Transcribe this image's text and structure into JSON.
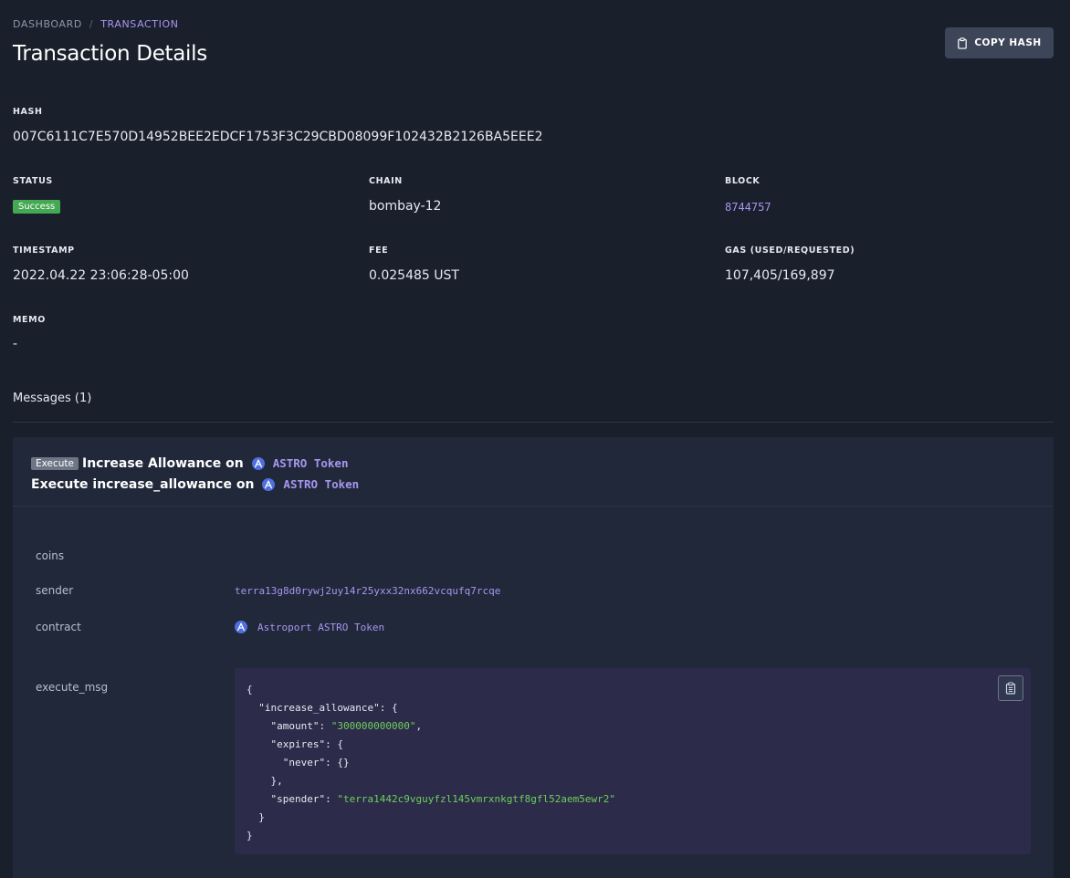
{
  "breadcrumb": {
    "root": "DASHBOARD",
    "separator": "/",
    "current": "TRANSACTION"
  },
  "page_title": "Transaction Details",
  "copy_button_label": "COPY HASH",
  "hash": {
    "label": "HASH",
    "value": "007C6111C7E570D14952BEE2EDCF1753F3C29CBD08099F102432B2126BA5EEE2"
  },
  "status": {
    "label": "STATUS",
    "value": "Success",
    "color": "#45a853"
  },
  "chain": {
    "label": "CHAIN",
    "value": "bombay-12"
  },
  "block": {
    "label": "BLOCK",
    "value": "8744757"
  },
  "timestamp": {
    "label": "TIMESTAMP",
    "value": "2022.04.22 23:06:28-05:00"
  },
  "fee": {
    "label": "FEE",
    "value": "0.025485 UST"
  },
  "gas": {
    "label": "GAS (USED/REQUESTED)",
    "value": "107,405/169,897"
  },
  "memo": {
    "label": "MEMO",
    "value": "-"
  },
  "messages": {
    "heading": "Messages (1)",
    "items": [
      {
        "tag": "Execute",
        "summary": "Increase Allowance on",
        "summary_token": "ASTRO Token",
        "detail": "Execute increase_allowance on",
        "detail_token": "ASTRO Token",
        "fields": {
          "coins_label": "coins",
          "sender_label": "sender",
          "sender_value": "terra13g8d0rywj2uy14r25yxx32nx662vcqufq7rcqe",
          "contract_label": "contract",
          "contract_value": "Astroport ASTRO Token",
          "execute_msg_label": "execute_msg"
        },
        "execute_msg": {
          "open": "{",
          "l1": "\"increase_allowance\": {",
          "amount_key": "\"amount\": ",
          "amount_val": "\"300000000000\"",
          "comma": ",",
          "expires_key": "\"expires\": {",
          "never": "\"never\": {}",
          "expires_close": "},",
          "spender_key": "\"spender\": ",
          "spender_val": "\"terra1442c9vguyfzl145vmrxnkgtf8gfl52aem5ewr2\"",
          "l1_close": "}",
          "close": "}"
        }
      }
    ]
  },
  "accent_color": "#a896f0",
  "string_color": "#6fcf5a"
}
